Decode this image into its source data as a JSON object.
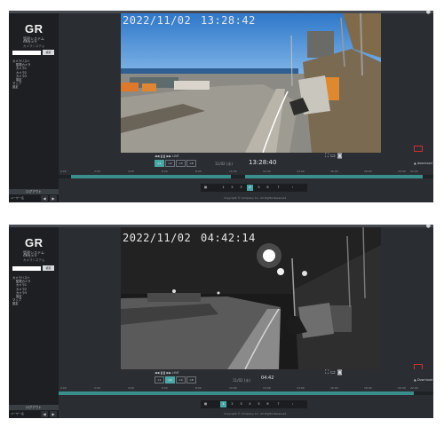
{
  "app": {
    "logo": "GR",
    "logo_sub": "管理システム"
  },
  "top_panel": {
    "brand_lines": [
      "GRカメラ",
      "カメラシステム"
    ],
    "search": {
      "placeholder": "",
      "button": "検索"
    },
    "nav": [
      "カメラリスト",
      "監視カメラ",
      "カメラ1",
      "カメラ2",
      "カメラ3",
      "設定",
      "マップ",
      "設定"
    ],
    "sidebar_footer": "ログアウト",
    "user": "ユーザー名",
    "overlay": {
      "date": "2022/11/02",
      "time": "13:28:42"
    },
    "controls": {
      "label": "LIVE",
      "speeds": [
        "×1",
        "×2",
        "×4",
        "×8"
      ],
      "active_speed": 0,
      "date_small": "11/02 (水)",
      "time_big": "13:28:40",
      "download": "download"
    },
    "timeline_ticks": [
      "0:00",
      "2:00",
      "4:00",
      "6:00",
      "8:00",
      "10:00",
      "12:00",
      "14:00",
      "16:00",
      "18:00",
      "20:00",
      "22:00"
    ],
    "pager": [
      "1",
      "2",
      "3",
      "4",
      "5",
      "6",
      "7"
    ],
    "active_page": 4,
    "copyright": "Copyright © Company Inc. All Rights Reserved."
  },
  "bottom_panel": {
    "brand_lines": [
      "GRカメラ",
      "カメラシステム"
    ],
    "search": {
      "placeholder": "",
      "button": "検索"
    },
    "nav": [
      "カメラリスト",
      "監視カメラ",
      "カメラ1",
      "カメラ2",
      "カメラ3",
      "設定",
      "マップ",
      "設定"
    ],
    "sidebar_footer": "ログアウト",
    "user": "ユーザー名",
    "overlay": {
      "date": "2022/11/02",
      "time": "04:42:14"
    },
    "controls": {
      "label": "LIVE",
      "speeds": [
        "×1",
        "×2",
        "×4",
        "×8"
      ],
      "active_speed": 1,
      "date_small": "11/02 (水)",
      "time_big": "04:42",
      "download": "Download"
    },
    "timeline_ticks": [
      "0:00",
      "2:00",
      "4:00",
      "6:00",
      "8:00",
      "10:00",
      "12:00",
      "14:00",
      "16:00",
      "18:00",
      "20:00",
      "22:00"
    ],
    "pager": [
      "1",
      "2",
      "3",
      "4",
      "5",
      "6",
      "7"
    ],
    "active_page": 1,
    "copyright": "Copyright © Company Inc. All Rights Reserved."
  },
  "colors": {
    "accent": "#49a7a5",
    "panel": "#2a2d31",
    "sidebar": "#1d1f22"
  }
}
